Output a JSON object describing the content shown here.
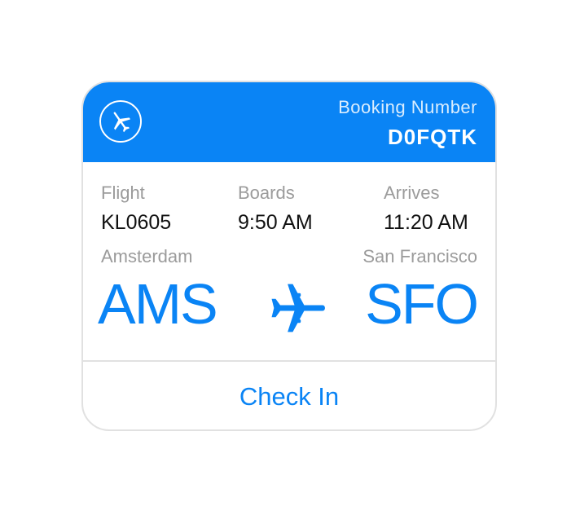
{
  "header": {
    "icon": "airplane-icon",
    "booking_label": "Booking Number",
    "booking_number": "D0FQTK",
    "accent_color": "#0a84f5"
  },
  "details": {
    "flight": {
      "label": "Flight",
      "value": "KL0605"
    },
    "boards": {
      "label": "Boards",
      "value": "9:50 AM"
    },
    "arrives": {
      "label": "Arrives",
      "value": "11:20 AM"
    }
  },
  "route": {
    "origin": {
      "city": "Amsterdam",
      "code": "AMS"
    },
    "destination": {
      "city": "San Francisco",
      "code": "SFO"
    },
    "icon": "airplane-icon"
  },
  "actions": {
    "check_in_label": "Check In"
  }
}
